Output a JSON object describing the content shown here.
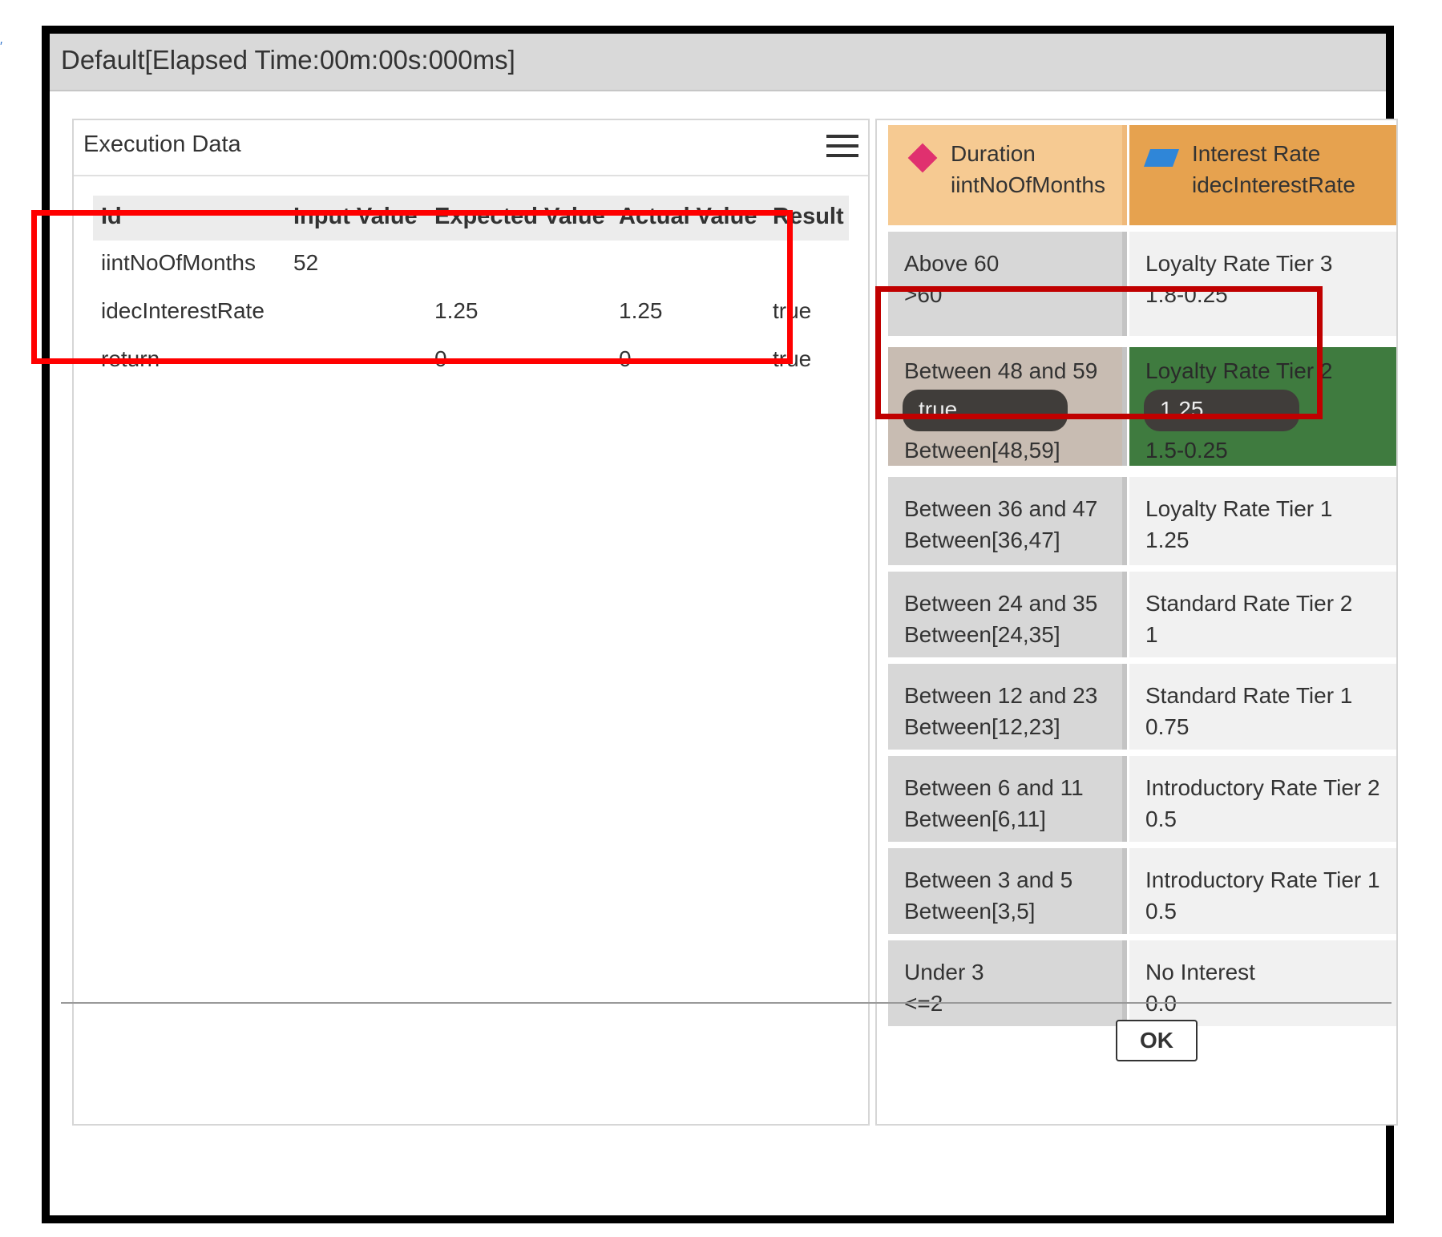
{
  "window": {
    "title": "Default[Elapsed Time:00m:00s:000ms]"
  },
  "execution_panel": {
    "title": "Execution Data",
    "menu_icon": "hamburger-menu-icon",
    "columns": [
      "Id",
      "Input Value",
      "Expected Value",
      "Actual Value",
      "Result"
    ],
    "rows": [
      {
        "id": "iintNoOfMonths",
        "input": "52",
        "expected": "",
        "actual": "",
        "result": ""
      },
      {
        "id": "idecInterestRate",
        "input": "",
        "expected": "1.25",
        "actual": "1.25",
        "result": "true"
      },
      {
        "id": "return",
        "input": "",
        "expected": "0",
        "actual": "0",
        "result": "true"
      }
    ],
    "highlight_color": "#ff0000"
  },
  "decision_table": {
    "header": {
      "condition": {
        "icon": "diamond-icon",
        "label": "Duration",
        "variable": "iintNoOfMonths",
        "color": "#f6ca92"
      },
      "conclusion": {
        "icon": "parallelogram-icon",
        "label": "Interest Rate",
        "variable": "idecInterestRate",
        "color": "#e6a24f"
      }
    },
    "rows": [
      {
        "condition_label": "Above 60",
        "condition_expr": ">60",
        "conclusion_label": "Loyalty Rate Tier 3",
        "conclusion_expr": "1.8-0.25",
        "active": false
      },
      {
        "condition_label": "Between 48 and 59",
        "condition_value": "true",
        "condition_expr": "Between[48,59]",
        "conclusion_label": "Loyalty Rate Tier 2",
        "conclusion_value": "1.25",
        "conclusion_expr": "1.5-0.25",
        "active": true
      },
      {
        "condition_label": "Between 36 and 47",
        "condition_expr": "Between[36,47]",
        "conclusion_label": "Loyalty Rate Tier 1",
        "conclusion_expr": "1.25",
        "active": false
      },
      {
        "condition_label": "Between 24 and 35",
        "condition_expr": "Between[24,35]",
        "conclusion_label": "Standard Rate Tier 2",
        "conclusion_expr": "1",
        "active": false
      },
      {
        "condition_label": "Between 12 and 23",
        "condition_expr": "Between[12,23]",
        "conclusion_label": "Standard Rate Tier 1",
        "conclusion_expr": "0.75",
        "active": false
      },
      {
        "condition_label": "Between 6 and 11",
        "condition_expr": "Between[6,11]",
        "conclusion_label": "Introductory Rate Tier 2",
        "conclusion_expr": "0.5",
        "active": false
      },
      {
        "condition_label": "Between 3 and 5",
        "condition_expr": "Between[3,5]",
        "conclusion_label": "Introductory Rate Tier 1",
        "conclusion_expr": "0.5",
        "active": false
      },
      {
        "condition_label": "Under 3",
        "condition_expr": "<=2",
        "conclusion_label": "No Interest",
        "conclusion_expr": "0.0",
        "active": false
      }
    ],
    "active_condition_color": "#c8bcb2",
    "active_conclusion_color": "#3f7b3f",
    "highlight_color": "#c00000"
  },
  "footer": {
    "ok_label": "OK"
  }
}
